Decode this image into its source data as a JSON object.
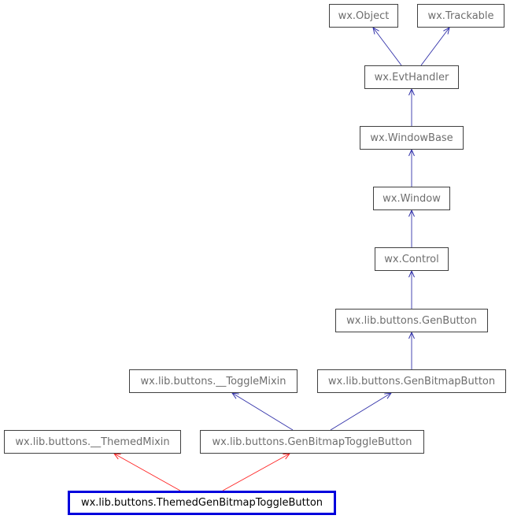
{
  "diagram": {
    "type": "inheritance-graph",
    "nodes": [
      {
        "id": "object",
        "label": "wx.Object"
      },
      {
        "id": "trackable",
        "label": "wx.Trackable"
      },
      {
        "id": "evthandler",
        "label": "wx.EvtHandler"
      },
      {
        "id": "windowbase",
        "label": "wx.WindowBase"
      },
      {
        "id": "window",
        "label": "wx.Window"
      },
      {
        "id": "control",
        "label": "wx.Control"
      },
      {
        "id": "genbutton",
        "label": "wx.lib.buttons.GenButton"
      },
      {
        "id": "togglemixin",
        "label": "wx.lib.buttons.__ToggleMixin"
      },
      {
        "id": "genbitmapbutton",
        "label": "wx.lib.buttons.GenBitmapButton"
      },
      {
        "id": "themedmixin",
        "label": "wx.lib.buttons.__ThemedMixin"
      },
      {
        "id": "genbitmaptogglebutton",
        "label": "wx.lib.buttons.GenBitmapToggleButton"
      },
      {
        "id": "themedgenbitmaptogglebutton",
        "label": "wx.lib.buttons.ThemedGenBitmapToggleButton",
        "highlighted": true
      }
    ],
    "edges": [
      {
        "from": "evthandler",
        "to": "object",
        "color": "#3333aa"
      },
      {
        "from": "evthandler",
        "to": "trackable",
        "color": "#3333aa"
      },
      {
        "from": "windowbase",
        "to": "evthandler",
        "color": "#3333aa"
      },
      {
        "from": "window",
        "to": "windowbase",
        "color": "#3333aa"
      },
      {
        "from": "control",
        "to": "window",
        "color": "#3333aa"
      },
      {
        "from": "genbutton",
        "to": "control",
        "color": "#3333aa"
      },
      {
        "from": "genbitmapbutton",
        "to": "genbutton",
        "color": "#3333aa"
      },
      {
        "from": "genbitmaptogglebutton",
        "to": "togglemixin",
        "color": "#3333aa"
      },
      {
        "from": "genbitmaptogglebutton",
        "to": "genbitmapbutton",
        "color": "#3333aa"
      },
      {
        "from": "themedgenbitmaptogglebutton",
        "to": "themedmixin",
        "color": "#ff2222"
      },
      {
        "from": "themedgenbitmaptogglebutton",
        "to": "genbitmaptogglebutton",
        "color": "#ff2222"
      }
    ]
  }
}
